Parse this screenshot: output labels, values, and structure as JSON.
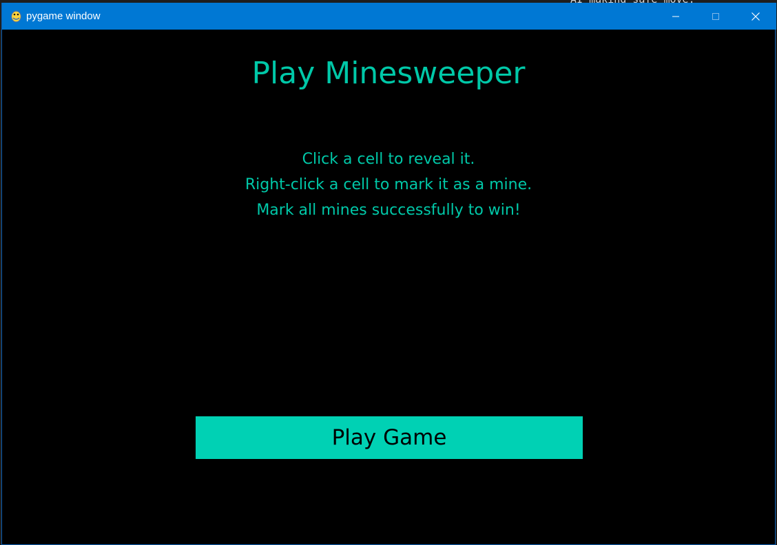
{
  "background": {
    "terminal_text": "AI making safe move:"
  },
  "window": {
    "title": "pygame window",
    "icon": "pygame-snake-icon",
    "controls": {
      "minimize_icon": "minimize-icon",
      "maximize_icon": "maximize-icon",
      "close_icon": "close-icon"
    },
    "titlebar_color": "#0078d4"
  },
  "game": {
    "title": "Play Minesweeper",
    "instructions": [
      "Click a cell to reveal it.",
      "Right-click a cell to mark it as a mine.",
      "Mark all mines successfully to win!"
    ],
    "play_button_label": "Play Game",
    "text_color": "#00c8a8",
    "button_color": "#00d1b4",
    "background_color": "#000000"
  }
}
